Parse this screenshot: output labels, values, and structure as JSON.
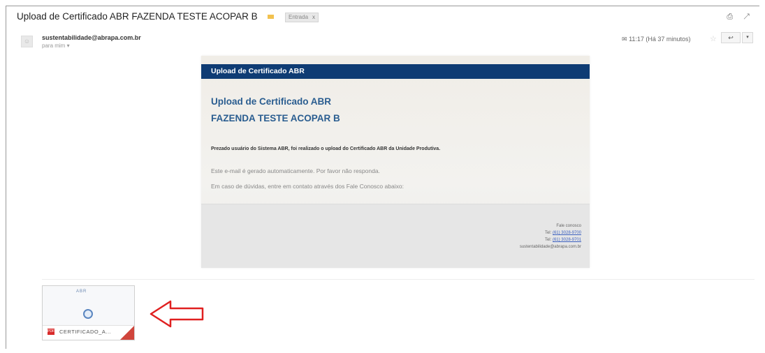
{
  "subject": "Upload de Certificado ABR FAZENDA TESTE ACOPAR B",
  "label_chip": "Entrada",
  "label_chip_close": "x",
  "top_icons": "⎙ ↗",
  "sender": {
    "email": "sustentabilidade@abrapa.com.br",
    "to": "para mim",
    "to_dropdown": "▾"
  },
  "time_info": "11:17 (Há 37 minutos)",
  "attachment_indicator": "✉",
  "star": "☆",
  "reply_label": "↩",
  "more_label": "▾",
  "email_body": {
    "header": "Upload de Certificado ABR",
    "title_line1": "Upload de Certificado ABR",
    "title_line2": "FAZENDA TESTE ACOPAR B",
    "message": "Prezado usuário do Sistema ABR, foi realizado o upload do Certificado ABR da Unidade Produtiva.",
    "auto_notice": "Este e-mail é gerado automaticamente. Por favor não responda.",
    "help_text": "Em caso de dúvidas, entre em contato através dos Fale Conosco abaixo:",
    "footer": {
      "contact_label": "Fale conosco",
      "phone1_label": "Tel:",
      "phone1": "(61) 3028-9700",
      "phone2_label": "Tel:",
      "phone2": "(61) 3028-9701",
      "email": "sustentabilidade@abrapa.com.br"
    }
  },
  "attachment": {
    "filename": "CERTIFICADO_A...",
    "logo_text": "ABR",
    "type": "PDF"
  },
  "colors": {
    "header_bg": "#0f3c74",
    "title_blue": "#2a5d90",
    "arrow_red": "#e02020"
  }
}
